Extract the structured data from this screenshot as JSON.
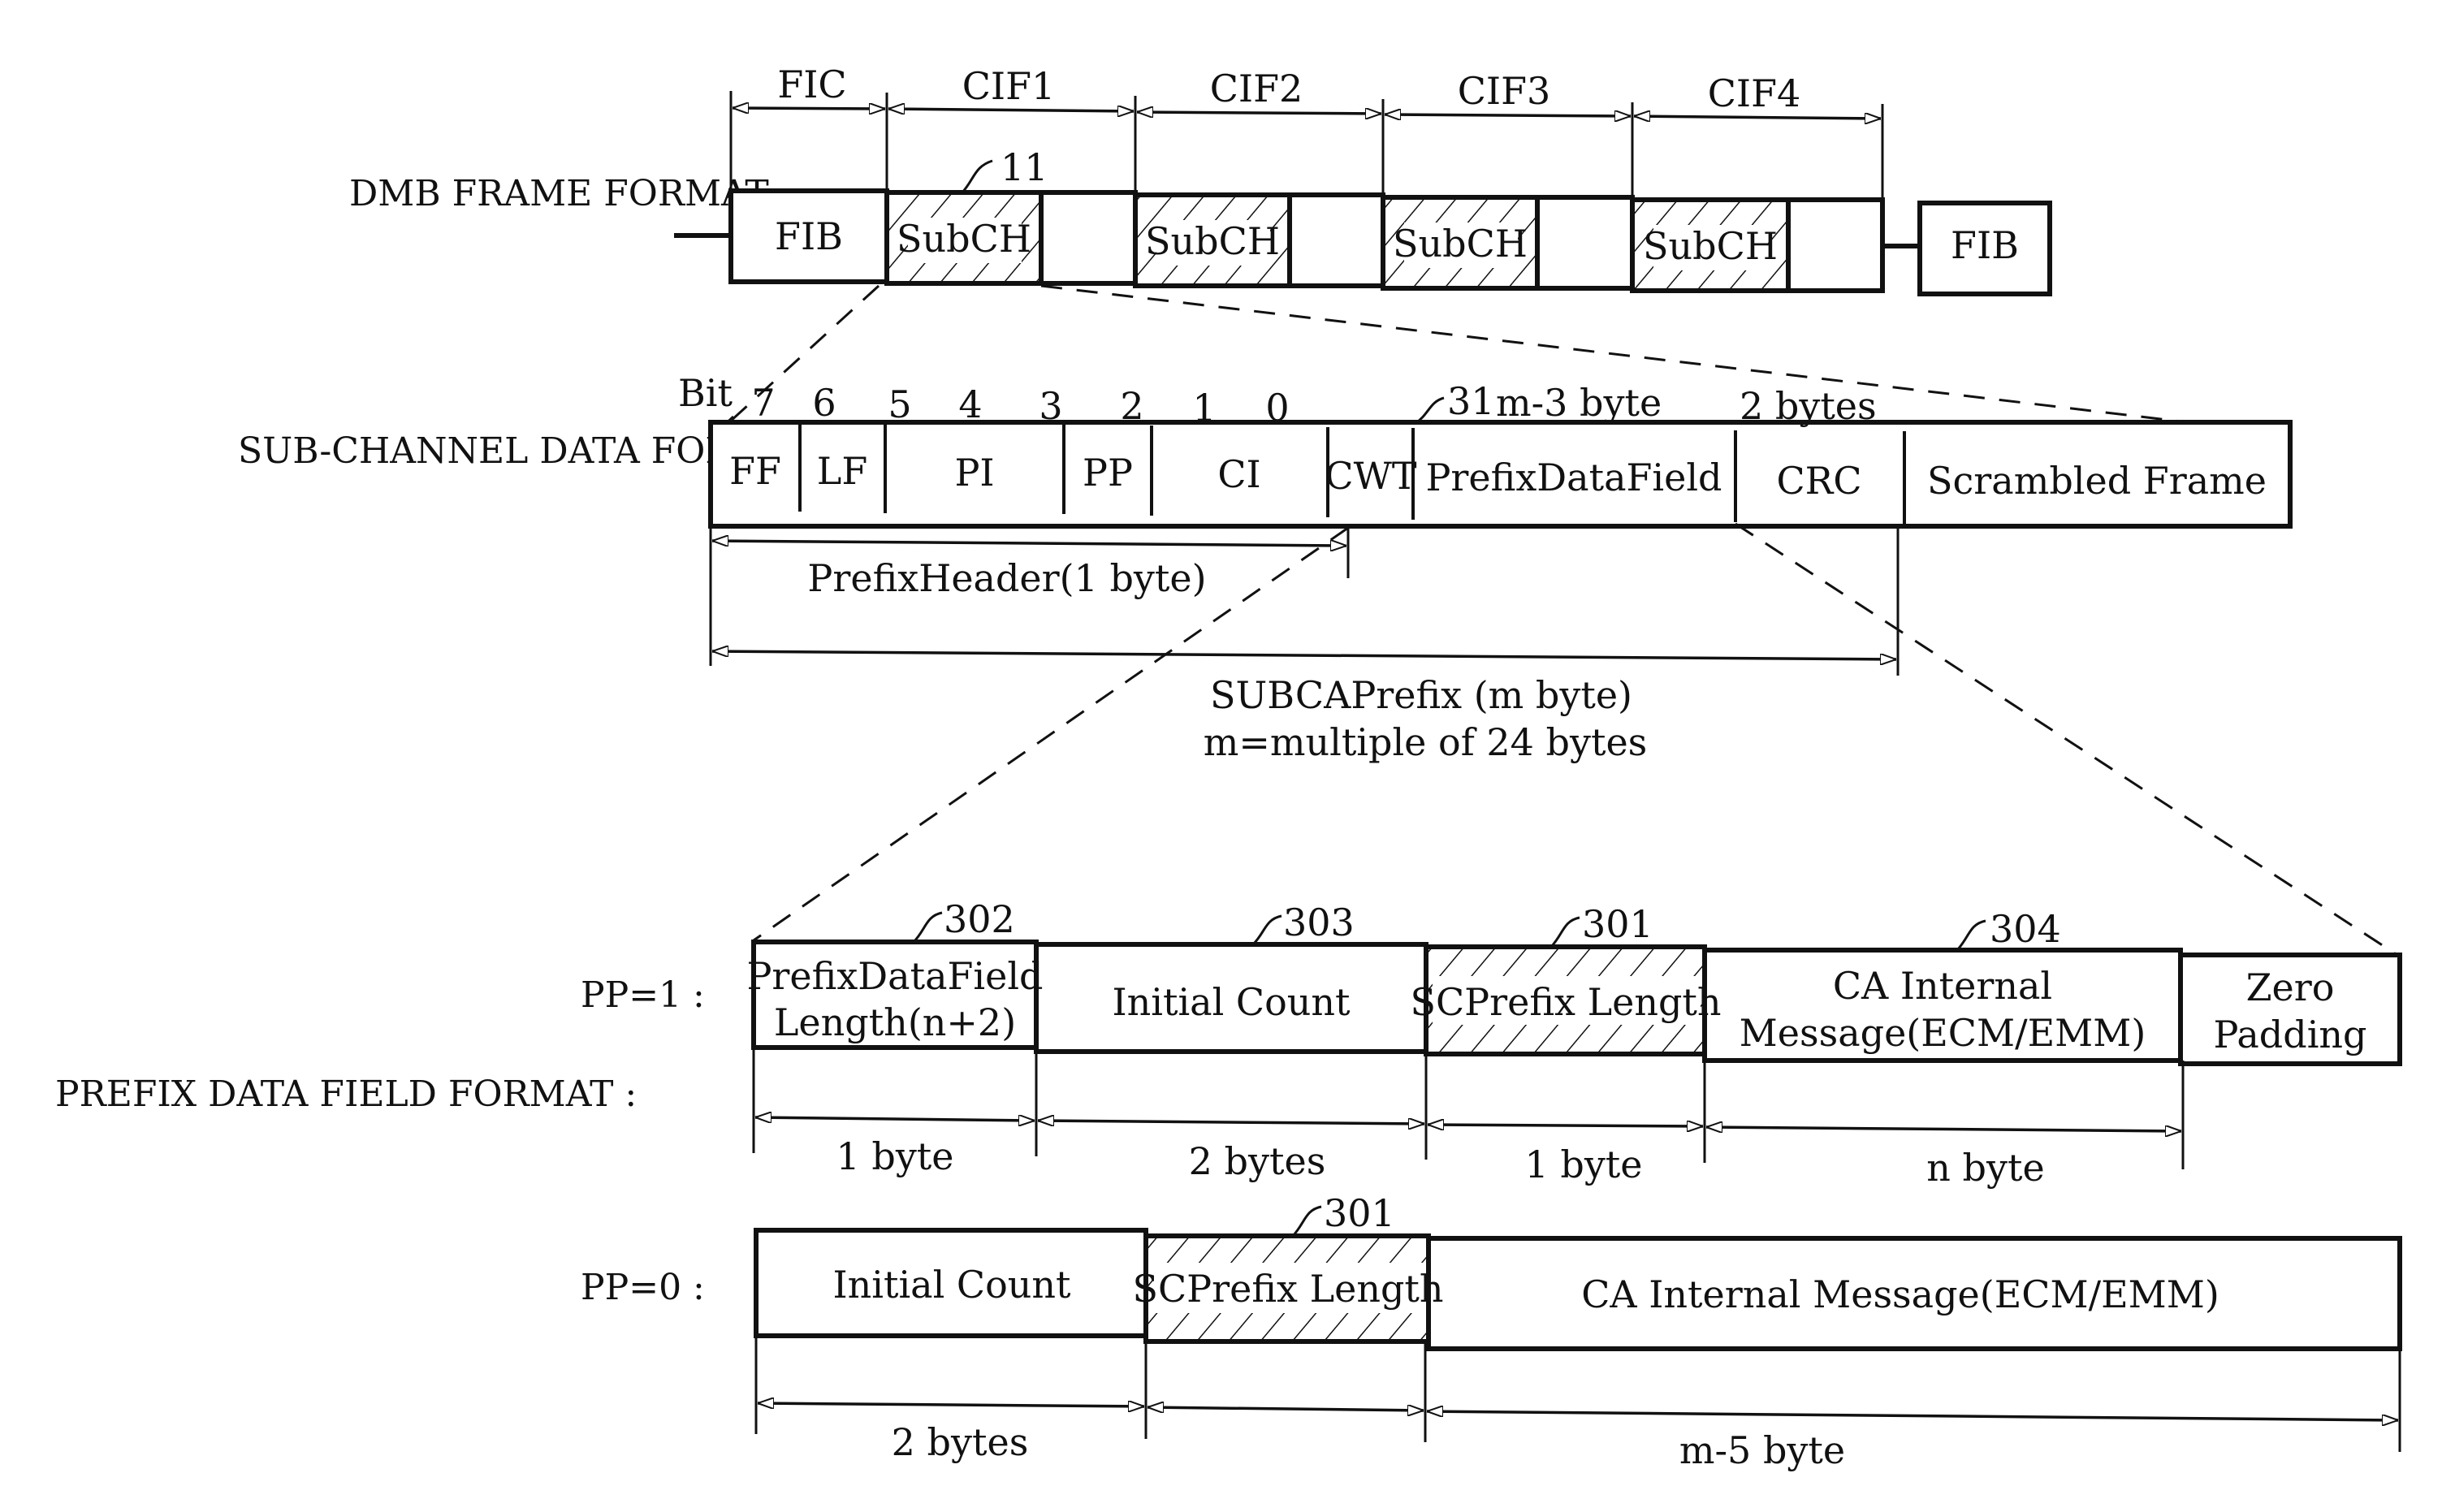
{
  "sections": {
    "dmb": {
      "label": "DMB FRAME FORMAT :",
      "segments": [
        {
          "name": "FIC",
          "cells": [
            {
              "text": "FIB",
              "hatched": false
            }
          ]
        },
        {
          "name": "CIF1",
          "cells": [
            {
              "text": "SubCH",
              "hatched": true
            },
            {
              "text": "",
              "hatched": false
            }
          ]
        },
        {
          "name": "CIF2",
          "cells": [
            {
              "text": "SubCH",
              "hatched": true
            },
            {
              "text": "",
              "hatched": false
            }
          ]
        },
        {
          "name": "CIF3",
          "cells": [
            {
              "text": "SubCH",
              "hatched": true
            },
            {
              "text": "",
              "hatched": false
            }
          ]
        },
        {
          "name": "CIF4",
          "cells": [
            {
              "text": "SubCH",
              "hatched": true
            },
            {
              "text": "",
              "hatched": false
            }
          ]
        }
      ],
      "trailing_box": "FIB",
      "ref_label": "11"
    },
    "subchannel": {
      "label": "SUB-CHANNEL DATA FORMAT :",
      "bit_label": "Bit",
      "bits": [
        "7",
        "6",
        "5",
        "4",
        "3",
        "2",
        "1",
        "0"
      ],
      "fields": [
        "FF",
        "LF",
        "PI",
        "PP",
        "CI",
        "CWT",
        "PrefixDataField",
        "CRC",
        "Scrambled Frame"
      ],
      "ref_label": "31",
      "size_prefixdata": "m-3 byte",
      "size_crc": "2 bytes",
      "prefix_header_dim": "PrefixHeader(1 byte)",
      "subca_dim_line1": "SUBCAPrefix (m byte)",
      "subca_dim_line2": "m=multiple of 24 bytes"
    },
    "prefix": {
      "label": "PREFIX DATA FIELD FORMAT :",
      "pp1": {
        "label": "PP=1 :",
        "cells": [
          {
            "lines": [
              "PrefixDataField",
              "Length(n+2)"
            ],
            "ref": "302",
            "hatched": false
          },
          {
            "lines": [
              "Initial Count"
            ],
            "ref": "303",
            "hatched": false
          },
          {
            "lines": [
              "SCPrefix Length"
            ],
            "ref": "301",
            "hatched": true
          },
          {
            "lines": [
              "CA Internal",
              "Message(ECM/EMM)"
            ],
            "ref": "304",
            "hatched": false
          },
          {
            "lines": [
              "Zero",
              "Padding"
            ],
            "ref": "",
            "hatched": false
          }
        ],
        "dims": [
          "1 byte",
          "2 bytes",
          "1 byte",
          "n byte"
        ]
      },
      "pp0": {
        "label": "PP=0 :",
        "cells": [
          {
            "lines": [
              "Initial Count"
            ],
            "ref": "",
            "hatched": false
          },
          {
            "lines": [
              "SCPrefix Length"
            ],
            "ref": "301",
            "hatched": true
          },
          {
            "lines": [
              "CA Internal Message(ECM/EMM)"
            ],
            "ref": "",
            "hatched": false
          }
        ],
        "dims": [
          "2 bytes",
          "",
          "m-5 byte"
        ]
      }
    }
  }
}
